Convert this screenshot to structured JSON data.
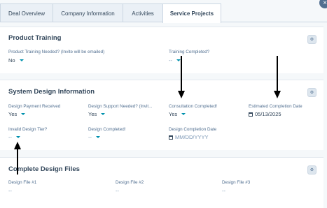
{
  "tabs": [
    {
      "label": "Deal Overview"
    },
    {
      "label": "Company Information"
    },
    {
      "label": "Activities"
    },
    {
      "label": "Service Projects"
    }
  ],
  "close_label": "×",
  "product_training": {
    "title": "Product Training",
    "fields": [
      {
        "label": "Product Training Needed? (Invite will be emailed)",
        "value": "No"
      },
      {
        "label": "Training Completed?",
        "value": "--"
      }
    ]
  },
  "system_design": {
    "title": "System Design Information",
    "fields": [
      {
        "label": "Design Payment Received",
        "value": "Yes"
      },
      {
        "label": "Design Support Needed? (Invit...",
        "value": "Yes"
      },
      {
        "label": "Consultation Completed!",
        "value": "Yes"
      },
      {
        "label": "Estimated Completion Date",
        "value": "05/13/2025"
      },
      {
        "label": "Invalid Design Tier?",
        "value": "--"
      },
      {
        "label": "Design Completed!",
        "value": "--"
      },
      {
        "label": "Design Completion Date",
        "value": "MM/DD/YYYY"
      }
    ]
  },
  "design_files": {
    "title": "Complete Design Files",
    "fields": [
      {
        "label": "Design File #1",
        "value": "--"
      },
      {
        "label": "Design File #2",
        "value": "--"
      },
      {
        "label": "Design File #3",
        "value": "--"
      }
    ]
  }
}
